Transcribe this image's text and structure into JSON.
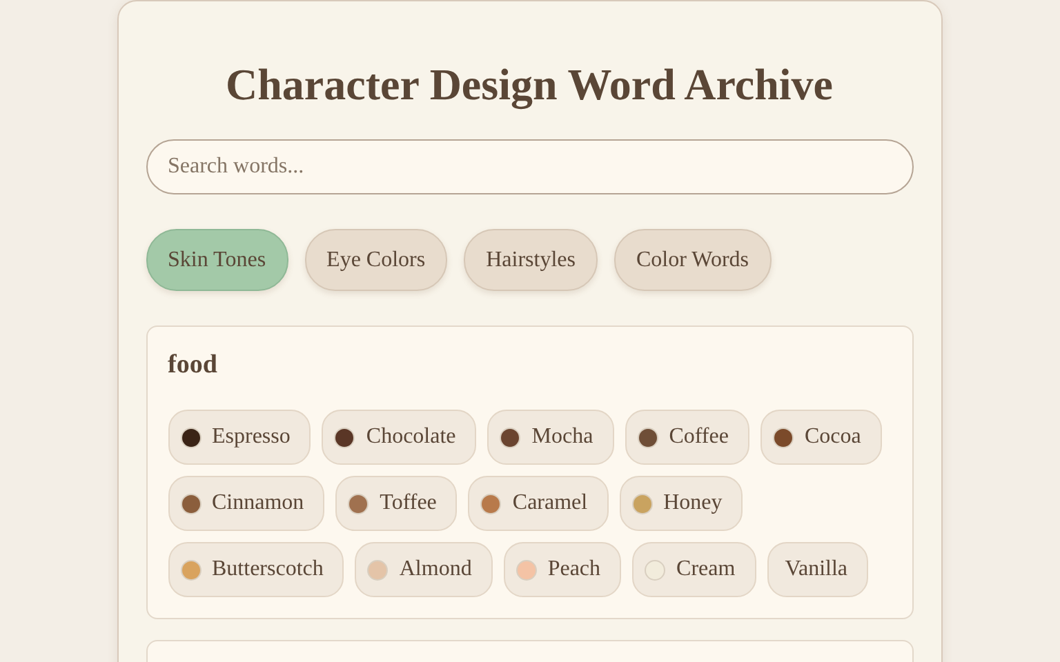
{
  "title": "Character Design Word Archive",
  "search": {
    "placeholder": "Search words..."
  },
  "tabs": [
    {
      "label": "Skin Tones",
      "selected": true
    },
    {
      "label": "Eye Colors",
      "selected": false
    },
    {
      "label": "Hairstyles",
      "selected": false
    },
    {
      "label": "Color Words",
      "selected": false
    }
  ],
  "sections": [
    {
      "heading": "food",
      "words": [
        {
          "label": "Espresso",
          "color": "#3b2416"
        },
        {
          "label": "Chocolate",
          "color": "#5a3626"
        },
        {
          "label": "Mocha",
          "color": "#6b4530"
        },
        {
          "label": "Coffee",
          "color": "#6f4e37"
        },
        {
          "label": "Cocoa",
          "color": "#7b4a2a"
        },
        {
          "label": "Cinnamon",
          "color": "#8b5e3c"
        },
        {
          "label": "Toffee",
          "color": "#a0714f"
        },
        {
          "label": "Caramel",
          "color": "#b87a4b"
        },
        {
          "label": "Honey",
          "color": "#c9a360"
        },
        {
          "label": "Butterscotch",
          "color": "#d9a35e"
        },
        {
          "label": "Almond",
          "color": "#e4c4a8"
        },
        {
          "label": "Peach",
          "color": "#f4c3a5"
        },
        {
          "label": "Cream",
          "color": "#f2ecdc"
        },
        {
          "label": "Vanilla"
        }
      ]
    },
    {
      "kind": "placeholder"
    }
  ]
}
